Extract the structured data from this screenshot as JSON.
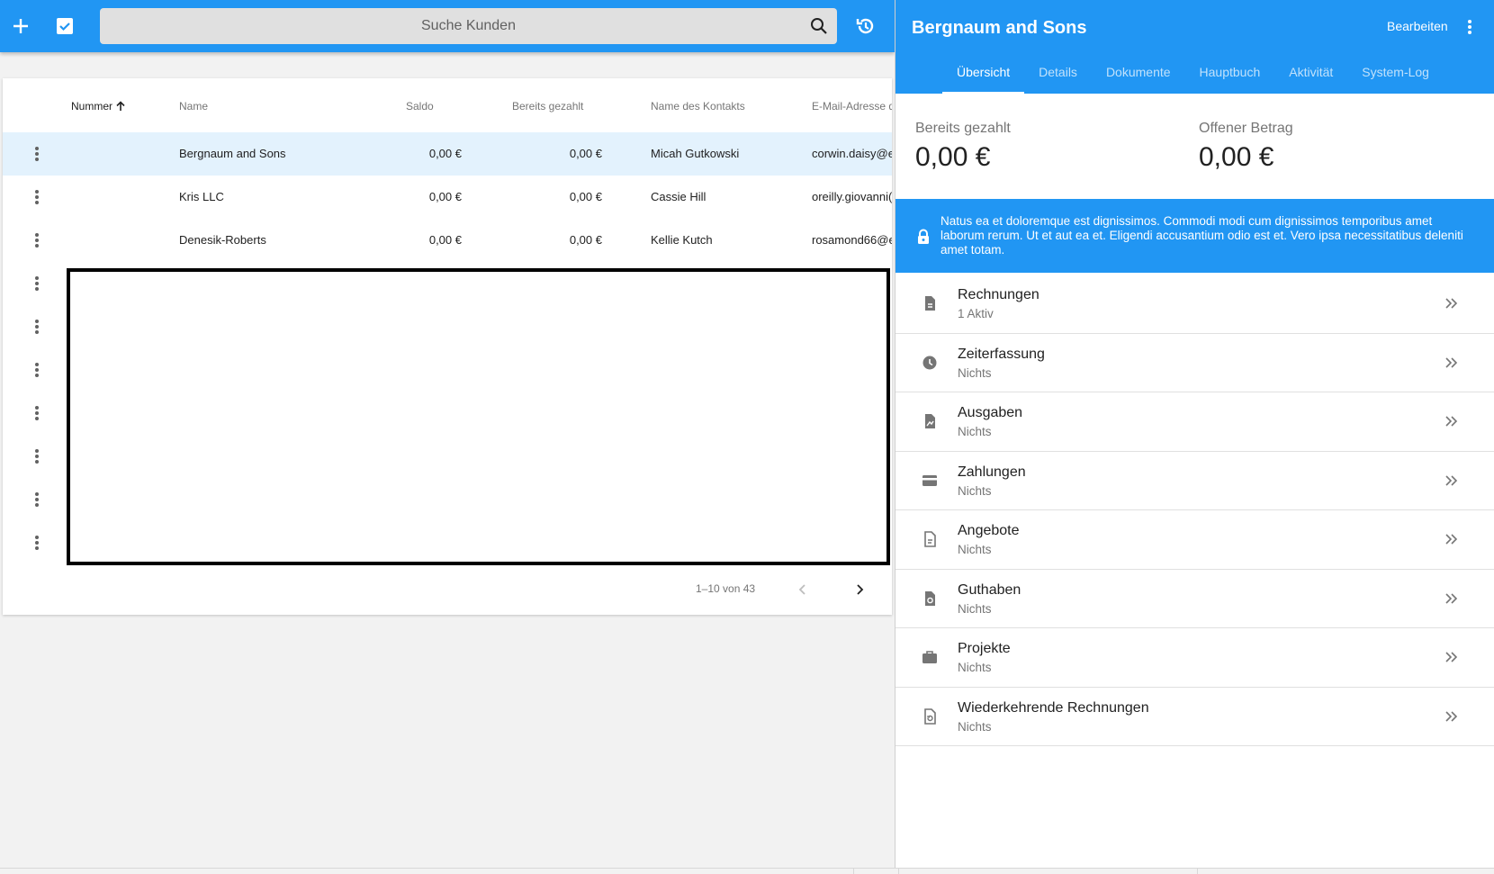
{
  "topbar": {
    "add_icon": "plus-icon",
    "select_icon": "checkbox-icon",
    "search_placeholder": "Suche Kunden",
    "search_icon": "search-icon",
    "history_icon": "history-icon"
  },
  "table": {
    "headers": {
      "number": "Nummer",
      "name": "Name",
      "balance": "Saldo",
      "paid": "Bereits gezahlt",
      "contact": "Name des Kontakts",
      "email": "E-Mail-Adresse d"
    },
    "rows": [
      {
        "name": "Bergnaum and Sons",
        "balance": "0,00 €",
        "paid": "0,00 €",
        "contact": "Micah Gutkowski",
        "email": "corwin.daisy@e"
      },
      {
        "name": "Kris LLC",
        "balance": "0,00 €",
        "paid": "0,00 €",
        "contact": "Cassie Hill",
        "email": "oreilly.giovanni("
      },
      {
        "name": "Denesik-Roberts",
        "balance": "0,00 €",
        "paid": "0,00 €",
        "contact": "Kellie Kutch",
        "email": "rosamond66@e"
      }
    ],
    "pagination": "1–10 von 43"
  },
  "panel": {
    "title": "Bergnaum and Sons",
    "edit_label": "Bearbeiten",
    "tabs": [
      "Übersicht",
      "Details",
      "Dokumente",
      "Hauptbuch",
      "Aktivität",
      "System-Log"
    ],
    "stats": [
      {
        "label": "Bereits gezahlt",
        "value": "0,00 €"
      },
      {
        "label": "Offener Betrag",
        "value": "0,00 €"
      }
    ],
    "banner": "Natus ea et doloremque est dignissimos. Commodi modi cum dignissimos temporibus amet laborum rerum. Ut et aut ea et. Eligendi accusantium odio est et. Vero ipsa necessitatibus deleniti amet totam.",
    "items": [
      {
        "title": "Rechnungen",
        "sub": "1 Aktiv",
        "icon": "invoice-icon"
      },
      {
        "title": "Zeiterfassung",
        "sub": "Nichts",
        "icon": "clock-icon"
      },
      {
        "title": "Ausgaben",
        "sub": "Nichts",
        "icon": "expense-icon"
      },
      {
        "title": "Zahlungen",
        "sub": "Nichts",
        "icon": "credit-card-icon"
      },
      {
        "title": "Angebote",
        "sub": "Nichts",
        "icon": "quote-icon"
      },
      {
        "title": "Guthaben",
        "sub": "Nichts",
        "icon": "credit-icon"
      },
      {
        "title": "Projekte",
        "sub": "Nichts",
        "icon": "briefcase-icon"
      },
      {
        "title": "Wiederkehrende Rechnungen",
        "sub": "Nichts",
        "icon": "recurring-invoice-icon"
      }
    ]
  },
  "colors": {
    "primary": "#2196f3",
    "selected_row": "#e3f2fd"
  }
}
